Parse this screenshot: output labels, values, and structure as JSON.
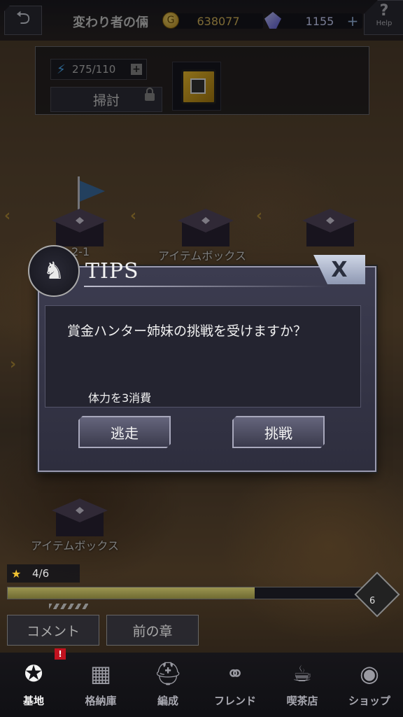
{
  "header": {
    "back_icon": "back-arrow-icon",
    "title": "変わり者の倆",
    "coins": "638077",
    "gems": "1155",
    "help_label": "Help"
  },
  "stage": {
    "stamina": "275/110",
    "sweep_label": "掃討",
    "reward_icon": "item-box-icon"
  },
  "map": {
    "node_left_label": "2-1",
    "node_mid_label": "アイテムボックス",
    "node_bottom_label": "アイテムボックス"
  },
  "dialog": {
    "title": "TIPS",
    "close_label": "X",
    "message": "賞金ハンター姉妹の挑戦を受けますか？",
    "cost": "体力を3消費",
    "flee_label": "逃走",
    "challenge_label": "挑戦"
  },
  "progress": {
    "stars": "4/6",
    "fraction": 0.685,
    "end_value": "6"
  },
  "buttons": {
    "comment": "コメント",
    "prev_chapter": "前の章"
  },
  "nav": {
    "items": [
      {
        "label": "基地",
        "icon": "base-icon"
      },
      {
        "label": "格納庫",
        "icon": "hangar-icon"
      },
      {
        "label": "編成",
        "icon": "formation-icon"
      },
      {
        "label": "フレンド",
        "icon": "handshake-icon"
      },
      {
        "label": "喫茶店",
        "icon": "cafe-icon"
      },
      {
        "label": "ショップ",
        "icon": "shop-icon"
      }
    ],
    "badge": "!"
  }
}
